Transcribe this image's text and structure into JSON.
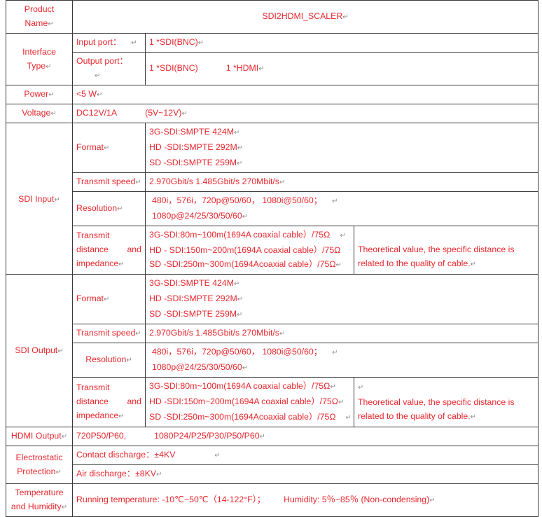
{
  "document": {
    "title": "SDI2HDMI_SCALER",
    "pilcrow": "↵",
    "text_color": "#e8262d",
    "border_color": "#3a3a3a"
  },
  "rows": {
    "product_name": {
      "label_line1": "Product",
      "label_line2": "Name",
      "value": "SDI2HDMI_SCALER"
    },
    "interface_type": {
      "label": "Interface Type",
      "input_port_label": "Input port：",
      "input_port_value": "1 *SDI(BNC)",
      "output_port_label": "Output port：",
      "output_port_value_a": "1 *SDI(BNC)",
      "output_port_value_b": "1 *HDMI"
    },
    "power": {
      "label": "Power",
      "value": "<5 W"
    },
    "voltage": {
      "label": "Voltage",
      "value_a": "DC12V/1A",
      "value_b": "(5V~12V)"
    },
    "sdi_input": {
      "label": "SDI Input",
      "format_label": "Format",
      "format_lines": [
        "3G-SDI:SMPTE 424M",
        "HD -SDI:SMPTE 292M",
        "SD -SDI:SMPTE 259M"
      ],
      "transmit_speed_label": "Transmit speed",
      "transmit_speed_value": "2.970Gbit/s 1.485Gbit/s 270Mbit/s",
      "resolution_label": "Resolution",
      "resolution_line1": "480i，576i，720p@50/60，   1080i@50/60；",
      "resolution_line2": "1080p@24/25/30/50/60",
      "distance_label_l1": "Transmit",
      "distance_label_l2": "distance   and",
      "distance_label_l3": "impedance",
      "distance_lines": [
        "3G-SDI:80m~100m(1694A coaxial cable）/75Ω",
        "HD - SDI:150m~200m(1694A coaxial cable）/75Ω",
        "SD -SDI:250m~300m(1694Acoaxial cable）/75Ω"
      ],
      "note_line1": "Theoretical  value,  the  specific  distance  is",
      "note_line2": "related to the quality of cable."
    },
    "sdi_output": {
      "label": "SDI Output",
      "format_label": "Format",
      "format_lines": [
        "3G-SDI:SMPTE 424M",
        "HD -SDI:SMPTE 292M",
        "SD -SDI:SMPTE 259M"
      ],
      "transmit_speed_label": "Transmit speed",
      "transmit_speed_value": "2.970Gbit/s 1.485Gbit/s 270Mbit/s",
      "resolution_label": "Resolution",
      "resolution_line1": "480i，576i，720p@50/60，   1080i@50/60；",
      "resolution_line2": "1080p@24/25/30/50/60",
      "distance_label_l1": "Transmit",
      "distance_label_l2": "distance   and",
      "distance_label_l3": "impedance",
      "distance_lines": [
        "3G-SDI:80m~100m(1694A coaxial cable）/75Ω",
        "HD -SDI:150m~200m(1694A coaxial cable）/75Ω",
        "SD -SDI:250m~300m(1694Acoaxial cable）/75Ω"
      ],
      "note_line1": "Theoretical  value,  the  specific  distance  is",
      "note_line2": "related to the quality of cable."
    },
    "hdmi_output": {
      "label": "HDMI Output",
      "value_a": "720P50/P60,",
      "value_b": "1080P24/P25/P30/P50/P60"
    },
    "electrostatic": {
      "label_l1": "Electrostatic",
      "label_l2": "Protection",
      "contact_discharge": "Contact discharge：±4KV",
      "air_discharge": "Air discharge：±8KV"
    },
    "temperature": {
      "label_l1": "Temperature",
      "label_l2": "and Humidity",
      "value_a": "Running temperature:  -10℃~50℃（14-122°F）；",
      "value_b": "Humidity: 5％~85％ (Non-condensing)"
    }
  }
}
